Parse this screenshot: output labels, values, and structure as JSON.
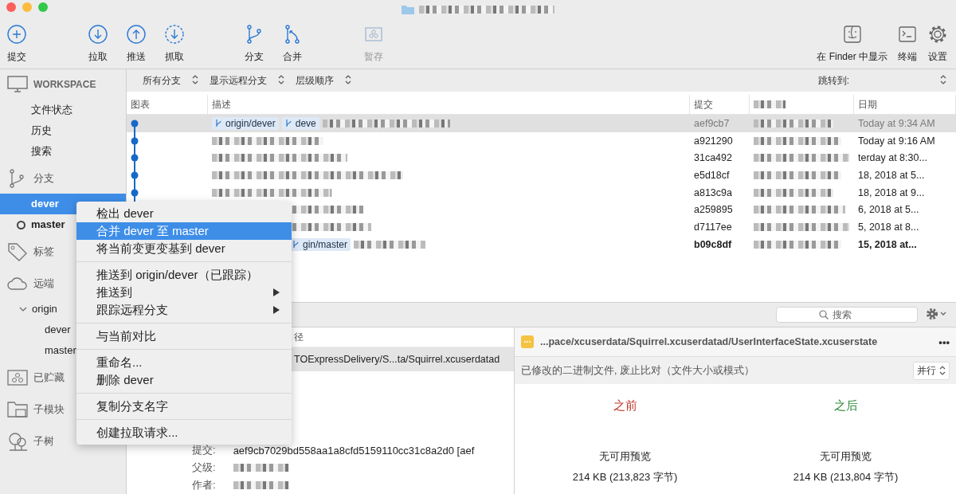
{
  "toolbar": {
    "left": [
      {
        "label": "提交",
        "disabled": false
      },
      {
        "label": "拉取",
        "disabled": false
      },
      {
        "label": "推送",
        "disabled": false
      },
      {
        "label": "抓取",
        "disabled": false
      },
      {
        "label": "分支",
        "disabled": false
      },
      {
        "label": "合并",
        "disabled": false
      },
      {
        "label": "暂存",
        "disabled": true
      }
    ],
    "right": [
      {
        "label": "在 Finder 中显示",
        "disabled": false
      },
      {
        "label": "终端",
        "disabled": false
      },
      {
        "label": "设置",
        "disabled": false
      }
    ]
  },
  "sidebar": [
    {
      "label": "WORKSPACE",
      "items": [
        {
          "label": "文件状态",
          "selected": false,
          "current": false
        },
        {
          "label": "历史",
          "selected": false,
          "current": false
        },
        {
          "label": "搜索",
          "selected": false,
          "current": false
        }
      ]
    },
    {
      "label": "分支",
      "items": [
        {
          "label": "dever",
          "selected": true,
          "current": false
        },
        {
          "label": "master",
          "selected": false,
          "current": true
        }
      ]
    },
    {
      "label": "标签"
    },
    {
      "label": "远端",
      "remotes": [
        {
          "label": "origin",
          "expanded": true,
          "children": [
            {
              "label": "dever",
              "selected": false
            },
            {
              "label": "master",
              "selected": false
            }
          ]
        }
      ]
    },
    {
      "label": "已贮藏"
    },
    {
      "label": "子模块"
    },
    {
      "label": "子树"
    }
  ],
  "filters": [
    "所有分支",
    "显示远程分支",
    "层级顺序"
  ],
  "jump_to": "跳转到:",
  "table": {
    "columns": [
      "图表",
      "描述",
      "提交",
      "",
      "日期"
    ],
    "rows": [
      {
        "tags": [
          "origin/dever",
          "deve"
        ],
        "commit": "aef9cb7",
        "date": "Today at 9:34 AM",
        "selected": true,
        "head": false
      },
      {
        "tags": [],
        "commit": "a921290",
        "date": "Today at 9:16 AM",
        "selected": false,
        "head": false
      },
      {
        "tags": [],
        "commit": "31ca492",
        "date": "terday at 8:30...",
        "selected": false,
        "head": false
      },
      {
        "tags": [],
        "commit": "e5d18cf",
        "date": "18, 2018 at 5...",
        "selected": false,
        "head": false
      },
      {
        "tags": [],
        "commit": "a813c9a",
        "date": "18, 2018 at 9...",
        "selected": false,
        "head": false
      },
      {
        "tags": [],
        "commit": "a259895",
        "date": "6, 2018 at 5...",
        "selected": false,
        "head": false
      },
      {
        "tags": [],
        "commit": "d7117ee",
        "date": "5, 2018 at 8...",
        "selected": false,
        "head": false
      },
      {
        "tags": [
          "gin/master"
        ],
        "commit": "b09c8df",
        "date": "15, 2018 at...",
        "selected": false,
        "head": true
      }
    ]
  },
  "search": {
    "placeholder": "搜索"
  },
  "files": {
    "column": "径",
    "rows": [
      {
        "path": "TOExpressDelivery/S...ta/Squirrel.xcuserdatad",
        "selected": true
      }
    ]
  },
  "details": [
    {
      "label": "提交:",
      "value": "aef9cb7029bd558aa1a8cfd5159110cc31c8a2d0 [aef"
    },
    {
      "label": "父级:"
    },
    {
      "label": "作者:"
    }
  ],
  "diff": {
    "path": "...pace/xcuserdata/Squirrel.xcuserdatad/UserInterfaceState.xcuserstate",
    "more": "•••",
    "note": "已修改的二进制文件, 废止比对（文件大小或模式）",
    "mode": "并行",
    "sides": [
      {
        "title": "之前",
        "color": "#c0392b",
        "preview": "无可用预览",
        "size": "214 KB (213,823 字节)"
      },
      {
        "title": "之后",
        "color": "#2e8b3a",
        "preview": "无可用预览",
        "size": "214 KB (213,804 字节)"
      }
    ]
  },
  "context_menu": [
    {
      "kind": "item",
      "label": "检出 dever",
      "selected": false,
      "submenu": false
    },
    {
      "kind": "item",
      "label": "合并 dever 至 master",
      "selected": true,
      "submenu": false
    },
    {
      "kind": "item",
      "label": "将当前变更变基到 dever",
      "selected": false,
      "submenu": false
    },
    {
      "kind": "separator"
    },
    {
      "kind": "item",
      "label": "推送到 origin/dever（已跟踪）",
      "selected": false,
      "submenu": false
    },
    {
      "kind": "item",
      "label": "推送到",
      "selected": false,
      "submenu": true
    },
    {
      "kind": "item",
      "label": "跟踪远程分支",
      "selected": false,
      "submenu": true
    },
    {
      "kind": "separator"
    },
    {
      "kind": "item",
      "label": "与当前对比",
      "selected": false,
      "submenu": false
    },
    {
      "kind": "separator"
    },
    {
      "kind": "item",
      "label": "重命名...",
      "selected": false,
      "submenu": false
    },
    {
      "kind": "item",
      "label": "删除 dever",
      "selected": false,
      "submenu": false
    },
    {
      "kind": "separator"
    },
    {
      "kind": "item",
      "label": "复制分支名字",
      "selected": false,
      "submenu": false
    },
    {
      "kind": "separator"
    },
    {
      "kind": "item",
      "label": "创建拉取请求...",
      "selected": false,
      "submenu": false
    }
  ]
}
